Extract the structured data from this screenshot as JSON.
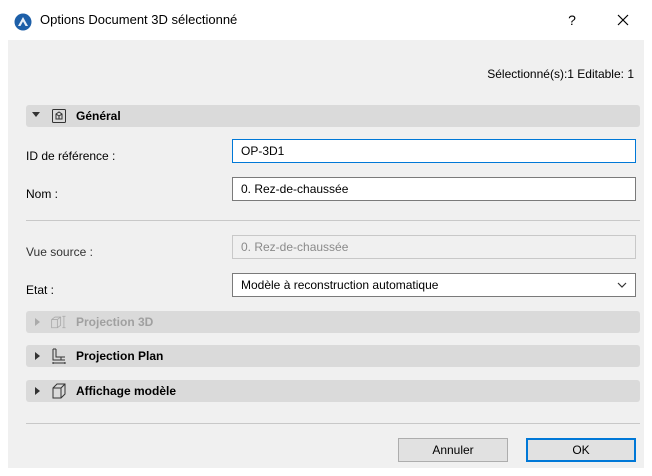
{
  "window": {
    "title": "Options Document 3D sélectionné",
    "help_label": "?"
  },
  "selection_info": "Sélectionné(s):1 Editable: 1",
  "general": {
    "label": "Général",
    "ref_id_label": "ID de référence :",
    "ref_id_value": "OP-3D1",
    "name_label": "Nom :",
    "name_value": "0. Rez-de-chaussée",
    "source_view_label": "Vue source :",
    "source_view_value": "0. Rez-de-chaussée",
    "state_label": "Etat :",
    "state_value": "Modèle à reconstruction automatique"
  },
  "sections": [
    {
      "label": "Projection 3D",
      "enabled": false
    },
    {
      "label": "Projection Plan",
      "enabled": true
    },
    {
      "label": "Affichage modèle",
      "enabled": true
    }
  ],
  "buttons": {
    "cancel": "Annuler",
    "ok": "OK"
  },
  "colors": {
    "accent": "#0078d7",
    "section_bg": "#dadada",
    "dialog_bg": "#f0f0f0"
  }
}
